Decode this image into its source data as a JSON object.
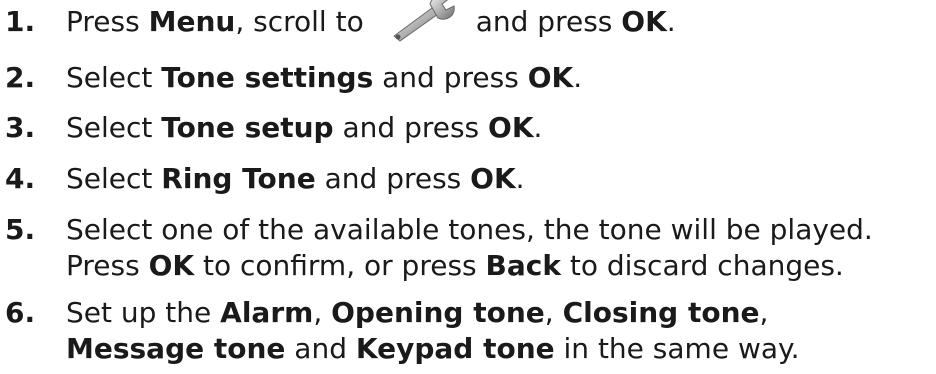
{
  "steps": [
    {
      "number": "1.",
      "parts": {
        "a": "Press ",
        "b1": "Menu",
        "c": ", scroll to",
        "d": "and press ",
        "b2": "OK",
        "e": "."
      },
      "icon": "wrench-settings-icon"
    },
    {
      "number": "2.",
      "parts": {
        "a": "Select ",
        "b1": "Tone settings",
        "c": " and press ",
        "b2": "OK",
        "d": "."
      }
    },
    {
      "number": "3.",
      "parts": {
        "a": "Select ",
        "b1": "Tone setup",
        "c": " and press ",
        "b2": "OK",
        "d": "."
      }
    },
    {
      "number": "4.",
      "parts": {
        "a": "Select ",
        "b1": "Ring Tone",
        "c": " and press ",
        "b2": "OK",
        "d": "."
      }
    },
    {
      "number": "5.",
      "line1": "Select one of the available tones, the tone will be played.",
      "line2": {
        "a": "Press ",
        "b1": "OK",
        "c": " to confirm, or press ",
        "b2": "Back",
        "d": " to discard changes."
      }
    },
    {
      "number": "6.",
      "line1": {
        "a": "Set up the ",
        "b1": "Alarm",
        "c": ", ",
        "b2": "Opening tone",
        "d": ", ",
        "b3": "Closing tone",
        "e": ","
      },
      "line2": {
        "b1": "Message tone",
        "a": " and ",
        "b2": "Keypad tone",
        "c": " in the same way."
      }
    }
  ]
}
